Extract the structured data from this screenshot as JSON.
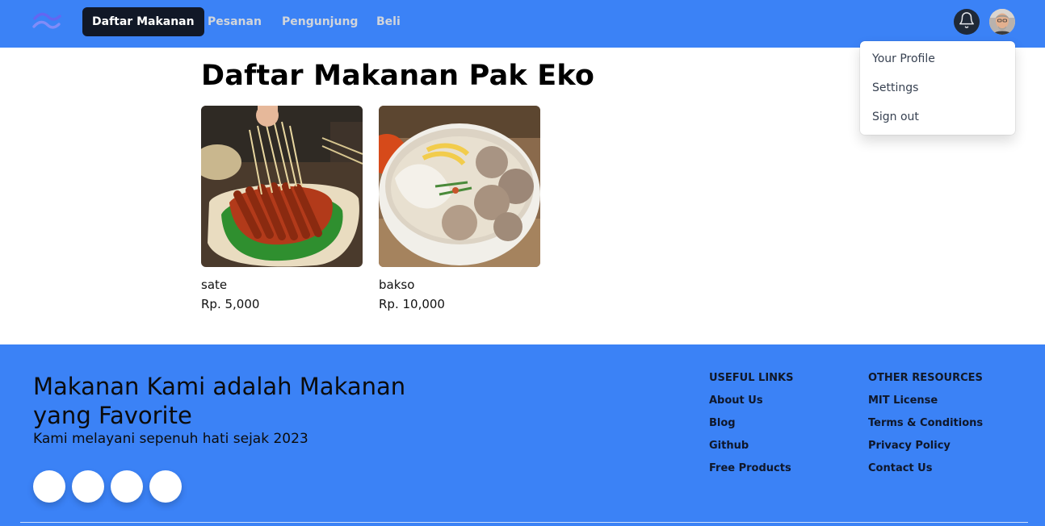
{
  "navbar": {
    "logo_icon": "tailwind-wave-icon",
    "items": [
      {
        "label": "Daftar Makanan",
        "active": true
      },
      {
        "label": "Pesanan",
        "active": false
      },
      {
        "label": "Pengunjung",
        "active": false
      },
      {
        "label": "Beli",
        "active": false
      }
    ],
    "bell_icon": "bell-icon",
    "avatar_icon": "user-avatar"
  },
  "dropdown": {
    "items": [
      {
        "label": "Your Profile"
      },
      {
        "label": "Settings"
      },
      {
        "label": "Sign out"
      }
    ]
  },
  "main": {
    "title": "Daftar Makanan Pak Eko",
    "foods": [
      {
        "name": "sate",
        "price": "Rp. 5,000",
        "image": "sate-photo"
      },
      {
        "name": "bakso",
        "price": "Rp. 10,000",
        "image": "bakso-photo"
      }
    ]
  },
  "footer": {
    "title": "Makanan Kami adalah Makanan yang Favorite",
    "subtitle": "Kami melayani sepenuh hati sejak 2023",
    "social_buttons": 4,
    "useful_links": {
      "heading": "USEFUL LINKS",
      "links": [
        "About Us",
        "Blog",
        "Github",
        "Free Products"
      ]
    },
    "other_resources": {
      "heading": "OTHER RESOURCES",
      "links": [
        "MIT License",
        "Terms & Conditions",
        "Privacy Policy",
        "Contact Us"
      ]
    }
  },
  "colors": {
    "brand_blue": "#3b82f6",
    "nav_active_bg": "#111827",
    "nav_inactive_text": "#d1d5db"
  }
}
